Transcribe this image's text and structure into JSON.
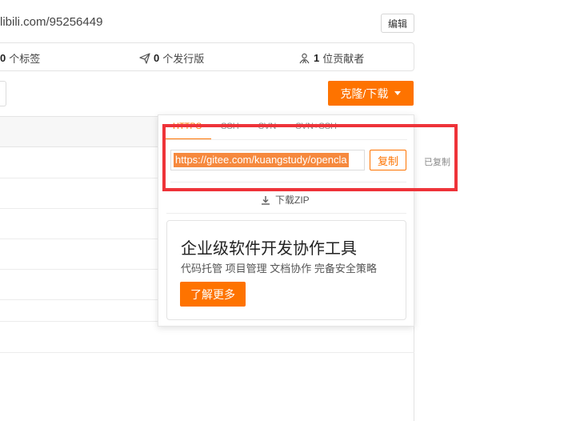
{
  "header": {
    "url_text": "libili.com/95256449",
    "edit_label": "编辑"
  },
  "stats": {
    "tags_count": "0",
    "tags_label": "个标签",
    "releases_count": "0",
    "releases_label": "个发行版",
    "contributors_count": "1",
    "contributors_label": "位贡献者"
  },
  "clone": {
    "button_label": "克隆/下载"
  },
  "dropdown": {
    "tabs": [
      "HTTPS",
      "SSH",
      "SVN",
      "SVN+SSH"
    ],
    "url_value": "https://gitee.com/kuangstudy/opencla",
    "copy_label": "复制",
    "copied_label": "已复制",
    "download_zip_label": "下载ZIP"
  },
  "promo": {
    "title": "企业级软件开发协作工具",
    "subtitle": "代码托管 项目管理 文档协作 完备安全策略",
    "button_label": "了解更多"
  },
  "colors": {
    "accent": "#fe7300",
    "highlight": "#ee3339"
  }
}
